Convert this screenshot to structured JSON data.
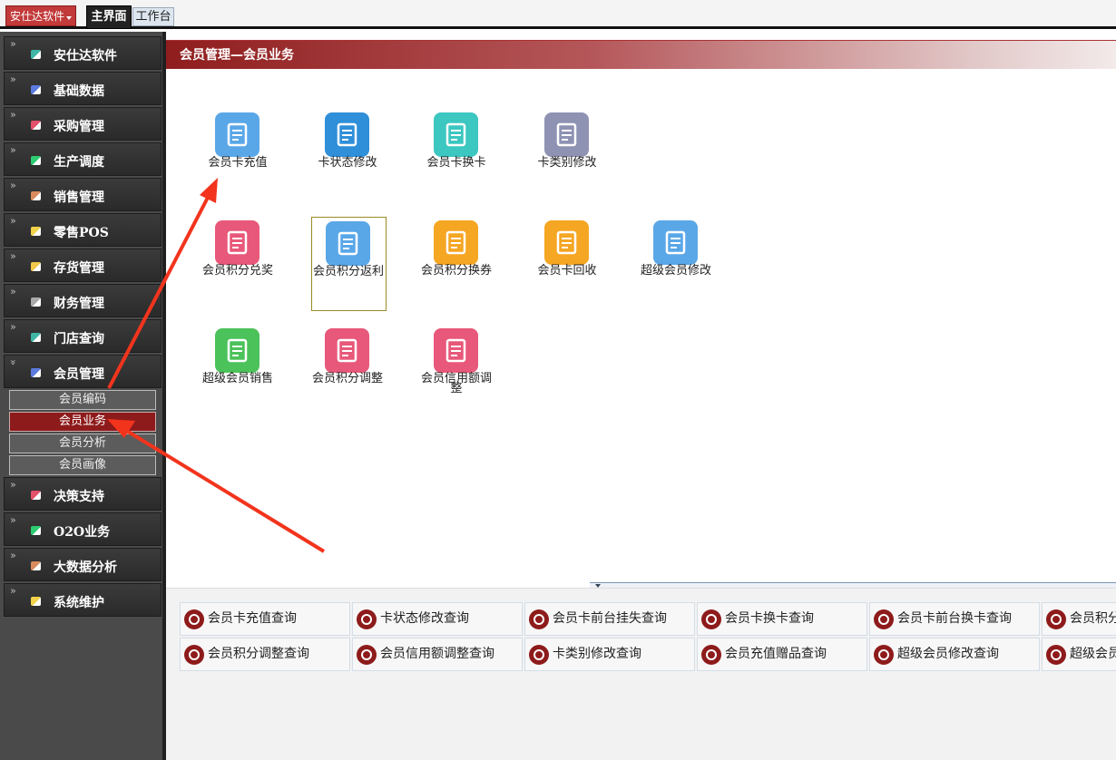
{
  "topbar": {
    "brand": "安仕达软件",
    "tab_main": "主界面",
    "tab_work": "工作台"
  },
  "sidebar": {
    "items": [
      {
        "label": "安仕达软件",
        "icon": "app-icon",
        "color": "#3fb6a6"
      },
      {
        "label": "基础数据",
        "icon": "database-icon",
        "color": "#5b7be0"
      },
      {
        "label": "采购管理",
        "icon": "purchase-icon",
        "color": "#e2506a"
      },
      {
        "label": "生产调度",
        "icon": "production-icon",
        "color": "#2ecc71"
      },
      {
        "label": "销售管理",
        "icon": "sales-icon",
        "color": "#d98b5f"
      },
      {
        "label": "零售POS",
        "icon": "pos-icon",
        "color": "#f1d24a"
      },
      {
        "label": "存货管理",
        "icon": "inventory-icon",
        "color": "#f1c84a"
      },
      {
        "label": "财务管理",
        "icon": "finance-icon",
        "color": "#aaaaaa"
      },
      {
        "label": "门店查询",
        "icon": "store-icon",
        "color": "#3fb6a6"
      },
      {
        "label": "会员管理",
        "icon": "member-icon",
        "color": "#5b7be0"
      }
    ],
    "sub_items": [
      {
        "label": "会员编码"
      },
      {
        "label": "会员业务"
      },
      {
        "label": "会员分析"
      },
      {
        "label": "会员画像"
      }
    ],
    "items_after": [
      {
        "label": "决策支持",
        "icon": "decision-icon",
        "color": "#e2506a"
      },
      {
        "label": "O2O业务",
        "icon": "o2o-icon",
        "color": "#2ecc71"
      },
      {
        "label": "大数据分析",
        "icon": "bigdata-icon",
        "color": "#d98b5f"
      },
      {
        "label": "系统维护",
        "icon": "system-icon",
        "color": "#f1d24a"
      }
    ]
  },
  "main": {
    "title": "会员管理—会员业务",
    "tiles": [
      {
        "label": "会员卡充值",
        "icon": "card-recharge-icon",
        "color": "#5aa7e8"
      },
      {
        "label": "卡状态修改",
        "icon": "card-status-icon",
        "color": "#2f8fd8"
      },
      {
        "label": "会员卡换卡",
        "icon": "card-change-icon",
        "color": "#3cc7c0"
      },
      {
        "label": "卡类别修改",
        "icon": "card-type-icon",
        "color": "#8e93b3"
      },
      {
        "label": "会员积分兑奖",
        "icon": "gift-icon",
        "color": "#e8587a"
      },
      {
        "label": "会员积分返利",
        "icon": "rebate-icon",
        "color": "#5aa7e8"
      },
      {
        "label": "会员积分换券",
        "icon": "coupon-icon",
        "color": "#f5a623"
      },
      {
        "label": "会员卡回收",
        "icon": "card-recycle-icon",
        "color": "#f5a623"
      },
      {
        "label": "超级会员修改",
        "icon": "super-edit-icon",
        "color": "#5aa7e8"
      },
      {
        "label": "超级会员销售",
        "icon": "super-sale-icon",
        "color": "#4cc25a"
      },
      {
        "label": "会员积分调整",
        "icon": "points-adjust-icon",
        "color": "#e8587a"
      },
      {
        "label": "会员信用额调整",
        "icon": "credit-adjust-icon",
        "color": "#e8587a"
      }
    ]
  },
  "quick": {
    "row1": [
      {
        "label": "会员卡充值查询",
        "icon": "heart-icon"
      },
      {
        "label": "卡状态修改查询",
        "icon": "layers-icon"
      },
      {
        "label": "会员卡前台挂失查询",
        "icon": "bar-chart-icon"
      },
      {
        "label": "会员卡换卡查询",
        "icon": "pie-icon"
      },
      {
        "label": "会员卡前台换卡查询",
        "icon": "share-icon"
      },
      {
        "label": "会员积分",
        "icon": "chat-icon"
      }
    ],
    "row2": [
      {
        "label": "会员积分调整查询",
        "icon": "check-icon"
      },
      {
        "label": "会员信用额调整查询",
        "icon": "heart-icon"
      },
      {
        "label": "卡类别修改查询",
        "icon": "tag-icon"
      },
      {
        "label": "会员充值赠品查询",
        "icon": "x-icon"
      },
      {
        "label": "超级会员修改查询",
        "icon": "heart-icon"
      },
      {
        "label": "超级会员",
        "icon": "database-icon"
      }
    ]
  }
}
